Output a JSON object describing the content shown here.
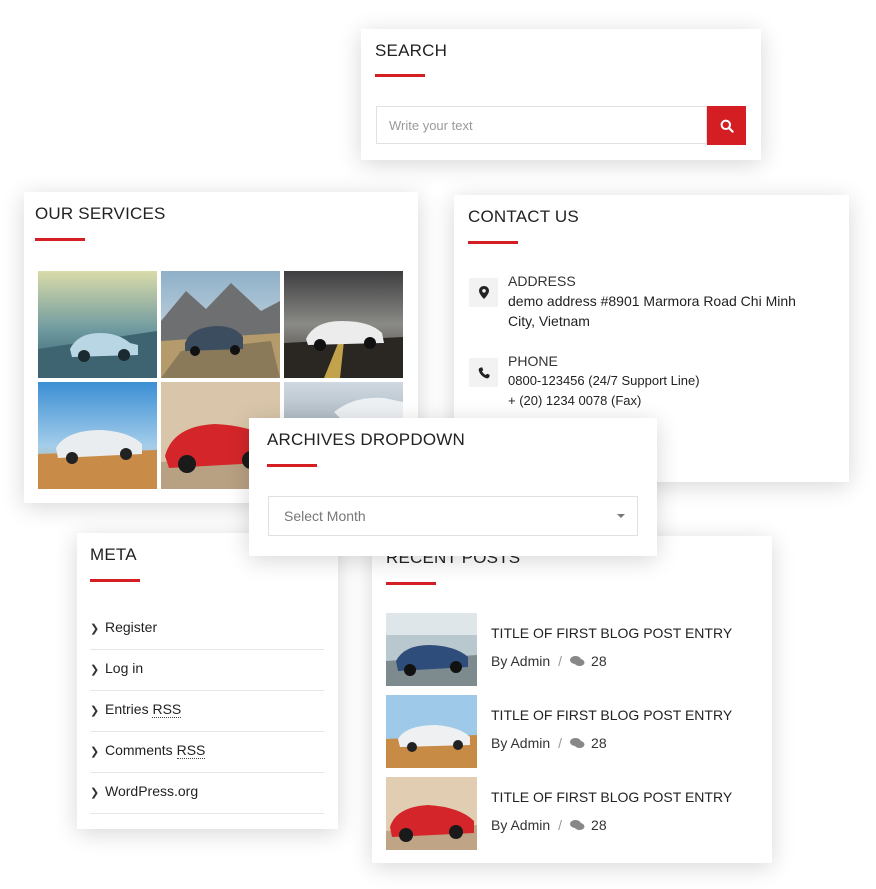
{
  "search": {
    "title": "SEARCH",
    "placeholder": "Write your text"
  },
  "services": {
    "title": "OUR SERVICES"
  },
  "contact": {
    "title": "CONTACT US",
    "address_label": "ADDRESS",
    "address_line1": "demo address #8901 Marmora Road Chi Minh",
    "address_line2": "City, Vietnam",
    "phone_label": "PHONE",
    "phone_line1": "0800-123456 (24/7 Support Line)",
    "phone_line2": "+ (20) 1234 0078 (Fax)"
  },
  "archives": {
    "title": "ARCHIVES DROPDOWN",
    "select_value": "Select Month"
  },
  "meta": {
    "title": "META",
    "items": [
      {
        "label": "Register"
      },
      {
        "label": "Log in"
      },
      {
        "label": "Entries",
        "abbr": "RSS"
      },
      {
        "label": "Comments",
        "abbr": "RSS"
      },
      {
        "label": "WordPress.org"
      }
    ]
  },
  "recent": {
    "title": "RECENT POSTS",
    "posts": [
      {
        "title": "TITLE OF FIRST BLOG POST ENTRY",
        "author": "By Admin",
        "sep": "/",
        "comments": "28"
      },
      {
        "title": "TITLE OF FIRST BLOG POST ENTRY",
        "author": "By Admin",
        "sep": "/",
        "comments": "28"
      },
      {
        "title": "TITLE OF FIRST BLOG POST ENTRY",
        "author": "By Admin",
        "sep": "/",
        "comments": "28"
      }
    ]
  },
  "colors": {
    "accent": "#d41e24",
    "icon_bg": "#f2f2f2"
  },
  "icons": {
    "search": "search-icon",
    "address": "map-marker-icon",
    "phone": "phone-icon",
    "comments": "comments-icon",
    "meta_bullet": "chevron-right-icon",
    "dropdown": "caret-down-icon"
  }
}
